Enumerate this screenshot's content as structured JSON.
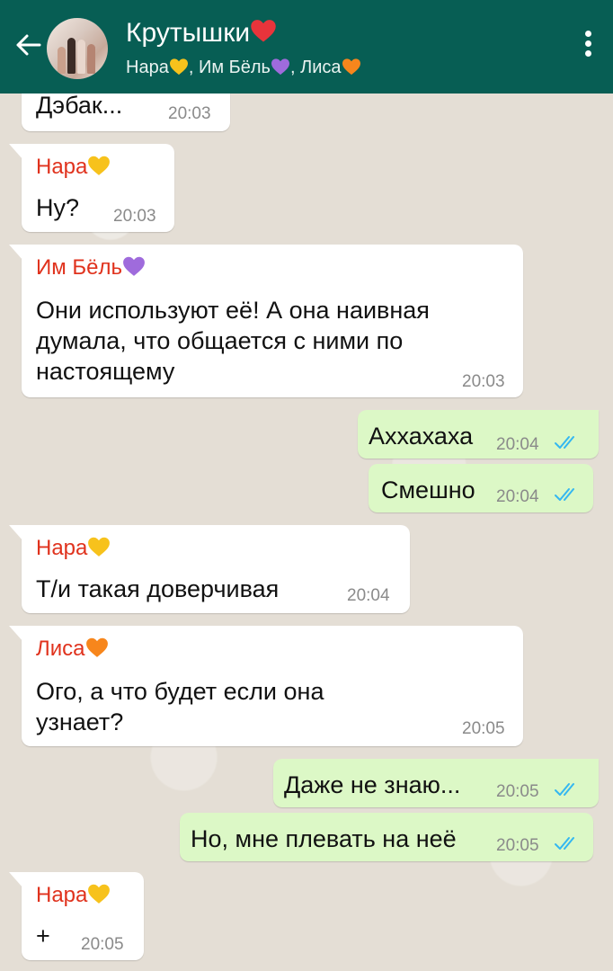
{
  "header": {
    "title": "Крутышки",
    "members": [
      {
        "name": "Нара",
        "heart": "yellow-heart-icon"
      },
      {
        "name": "Им Бёль",
        "heart": "purple-heart-icon"
      },
      {
        "name": "Лиса",
        "heart": "orange-heart-icon"
      }
    ],
    "separator": ", ",
    "title_heart": "red-heart-icon"
  },
  "colors": {
    "header_bg": "#075e54",
    "incoming_bubble": "#ffffff",
    "outgoing_bubble": "#dcf8c6",
    "sender_name": "#e0321d",
    "read_ticks": "#34b7f1",
    "heart_red": "#e8343b",
    "heart_yellow": "#f7c21c",
    "heart_purple": "#9f6bdc",
    "heart_orange": "#f7861c"
  },
  "messages": [
    {
      "id": "m1",
      "direction": "in",
      "sender": "",
      "text": "Дэбак...",
      "time": "20:03"
    },
    {
      "id": "m2",
      "direction": "in",
      "sender": "Нара",
      "sender_heart": "yellow",
      "text": "Ну?",
      "time": "20:03"
    },
    {
      "id": "m3",
      "direction": "in",
      "sender": "Им Бёль",
      "sender_heart": "purple",
      "text": "Они используют её! А она наивная думала, что общается с ними по настоящему",
      "time": "20:03"
    },
    {
      "id": "m4",
      "direction": "out",
      "text": "Аххахаха",
      "time": "20:04",
      "status": "read"
    },
    {
      "id": "m5",
      "direction": "out",
      "text": "Смешно",
      "time": "20:04",
      "status": "read"
    },
    {
      "id": "m6",
      "direction": "in",
      "sender": "Нара",
      "sender_heart": "yellow",
      "text": "Т/и такая доверчивая",
      "time": "20:04"
    },
    {
      "id": "m7",
      "direction": "in",
      "sender": "Лиса",
      "sender_heart": "orange",
      "text": "Ого, а что будет если она узнает?",
      "time": "20:05"
    },
    {
      "id": "m8",
      "direction": "out",
      "text": "Даже не знаю...",
      "time": "20:05",
      "status": "read"
    },
    {
      "id": "m9",
      "direction": "out",
      "text": "Но, мне плевать на неё",
      "time": "20:05",
      "status": "read"
    },
    {
      "id": "m10",
      "direction": "in",
      "sender": "Нара",
      "sender_heart": "yellow",
      "text": "+",
      "time": "20:05"
    }
  ]
}
